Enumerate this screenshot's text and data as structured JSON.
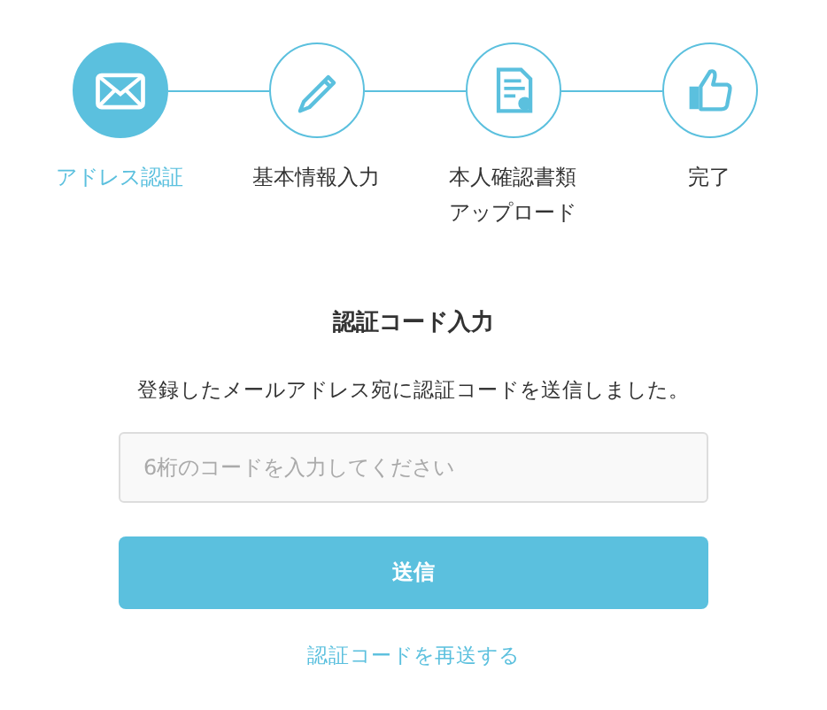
{
  "steps": [
    {
      "label": "アドレス認証",
      "kind": "mail",
      "selected": true
    },
    {
      "label": "基本情報入力",
      "kind": "pencil",
      "selected": false
    },
    {
      "label": "本人確認書類アップロード",
      "kind": "document",
      "selected": false
    },
    {
      "label": "完了",
      "kind": "thumb",
      "selected": false
    }
  ],
  "form": {
    "title": "認証コード入力",
    "message": "登録したメールアドレス宛に認証コードを送信しました。",
    "placeholder": "6桁のコードを入力してください",
    "submit": "送信",
    "resend_link": "認証コードを再送する"
  }
}
